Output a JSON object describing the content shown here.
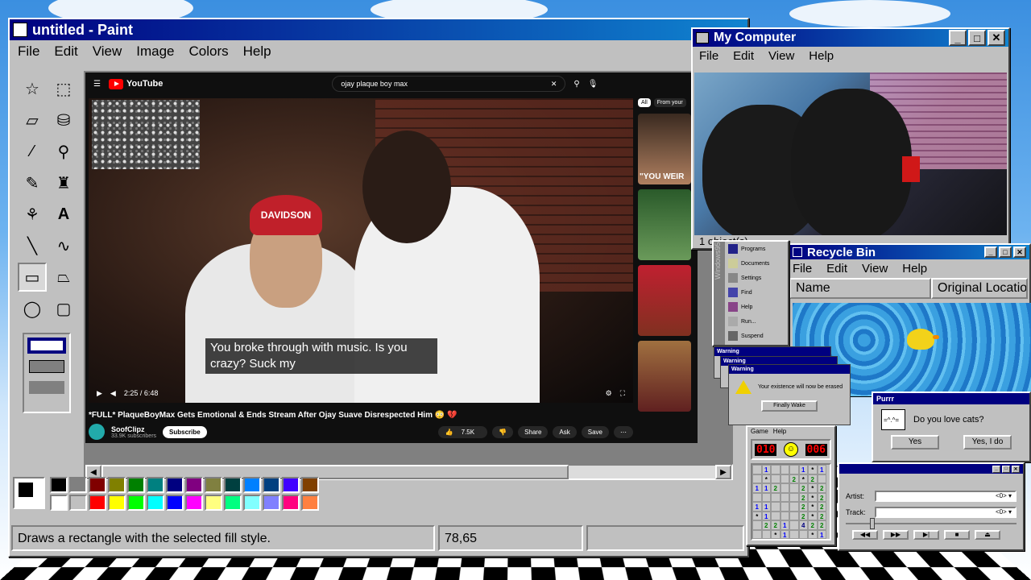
{
  "paint": {
    "title": "untitled - Paint",
    "menu": [
      "File",
      "Edit",
      "View",
      "Image",
      "Colors",
      "Help"
    ],
    "status_text": "Draws a rectangle with the selected fill style.",
    "coords": "78,65",
    "palette": [
      "#000000",
      "#808080",
      "#800000",
      "#808000",
      "#008000",
      "#008080",
      "#000080",
      "#800080",
      "#808040",
      "#004040",
      "#0080ff",
      "#004080",
      "#4000ff",
      "#804000",
      "#ffffff",
      "#c0c0c0",
      "#ff0000",
      "#ffff00",
      "#00ff00",
      "#00ffff",
      "#0000ff",
      "#ff00ff",
      "#ffff80",
      "#00ff80",
      "#80ffff",
      "#8080ff",
      "#ff0080",
      "#ff8040"
    ]
  },
  "youtube": {
    "brand": "YouTube",
    "search_query": "ojay plaque boy max",
    "hat_text": "DAVIDSON",
    "subtitle_line1": "You broke through with music. Is you",
    "subtitle_line2": "crazy? Suck my",
    "time": "2:25 / 6:48",
    "progress_fraction": 0.36,
    "video_title": "*FULL* PlaqueBoyMax Gets Emotional & Ends Stream After Ojay Suave Disrespected Him 😳 💔",
    "channel": "SoofClipz",
    "subscribers": "33.9K subscribers",
    "subscribe_label": "Subscribe",
    "likes": "7.5K",
    "share": "Share",
    "ask": "Ask",
    "save": "Save",
    "chips": [
      "All",
      "From your"
    ],
    "side_caption": "\"YOU WEIR"
  },
  "my_computer": {
    "title": "My Computer",
    "menu": [
      "File",
      "Edit",
      "View",
      "Help"
    ],
    "status": "1 object(s)"
  },
  "recycle_bin": {
    "title": "Recycle Bin",
    "menu": [
      "File",
      "Edit",
      "View",
      "Help"
    ],
    "col_name": "Name",
    "col_location": "Original Locatio"
  },
  "start_menu": {
    "band": "Windows95",
    "items": [
      "Programs",
      "Documents",
      "Settings",
      "Find",
      "Help",
      "Run...",
      "Suspend"
    ]
  },
  "warning": {
    "title": "Warning",
    "message": "Your existence will now be erased",
    "button": "Finally Wake"
  },
  "purr": {
    "title": "Purrr",
    "question": "Do you love cats?",
    "yes": "Yes",
    "yes_i_do": "Yes, I do"
  },
  "minesweeper": {
    "menu": [
      "Game",
      "Help"
    ],
    "mines_left": "010",
    "timer": "006",
    "cells": [
      "",
      "1",
      "",
      "",
      "",
      "1",
      "*",
      "1",
      "",
      "*",
      "",
      "",
      "2",
      "*",
      "2",
      "",
      "1",
      "1",
      "2",
      "",
      "",
      "2",
      "*",
      "2",
      "",
      "",
      "",
      "",
      "",
      "2",
      "*",
      "2",
      "1",
      "1",
      "",
      "",
      "",
      "2",
      "*",
      "2",
      "*",
      "1",
      "",
      "",
      "",
      "2",
      "*",
      "2",
      "",
      "2",
      "2",
      "1",
      "",
      "4",
      "2",
      "2",
      "",
      "",
      "*",
      "1",
      "",
      "",
      "*",
      "1"
    ]
  },
  "media": {
    "artist_label": "Artist:",
    "track_label": "Track:",
    "disc": "<0>"
  }
}
